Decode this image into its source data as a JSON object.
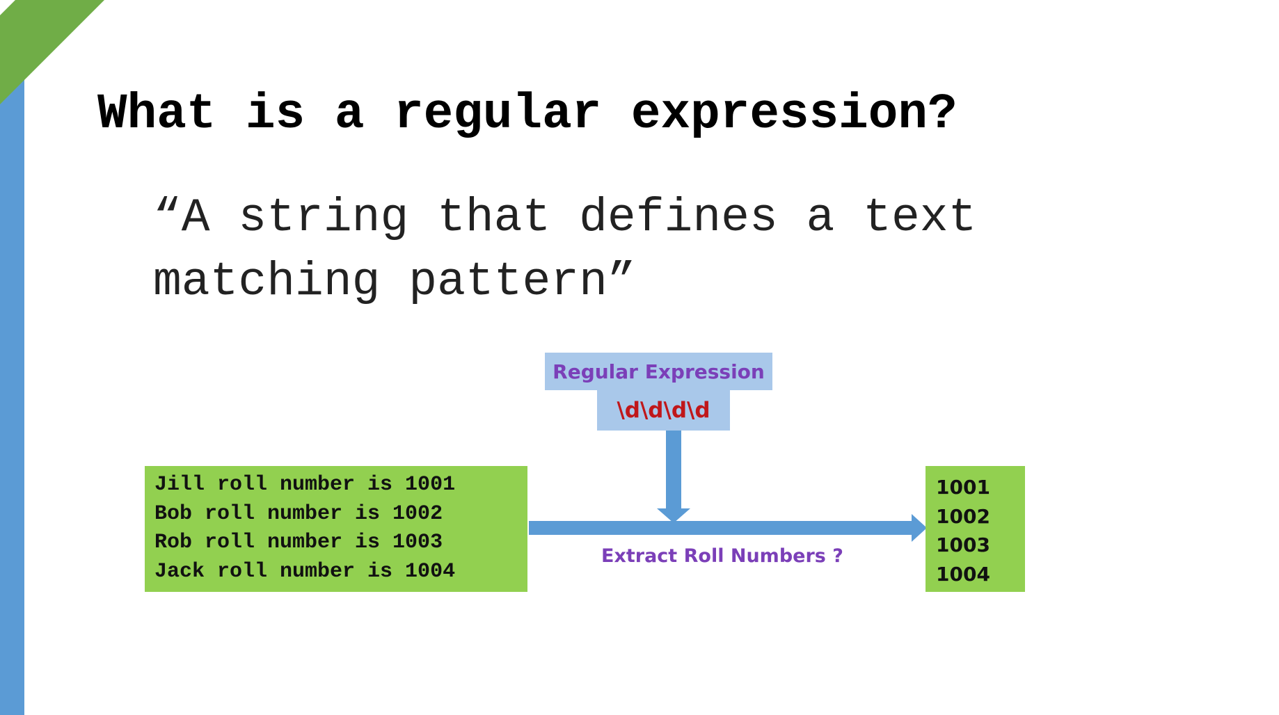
{
  "slide": {
    "title": "What is a regular expression?",
    "quote_lines": [
      "“A string that defines a  text",
      "matching pattern”"
    ]
  },
  "diagram": {
    "regex_label": "Regular Expression",
    "regex_pattern": "\\d\\d\\d\\d",
    "input_lines": [
      "Jill roll number is 1001",
      "Bob roll number is 1002",
      "Rob roll number is 1003",
      "Jack roll number is 1004"
    ],
    "action_label": "Extract Roll Numbers ?",
    "output_lines": [
      "1001",
      "1002",
      "1003",
      "1004"
    ]
  },
  "colors": {
    "accent_blue": "#5b9bd5",
    "corner_green": "#70ad47",
    "box_green": "#92d050",
    "box_light_blue": "#a9c8ea",
    "label_purple": "#7b3fb8",
    "pattern_red": "#c0171a"
  }
}
